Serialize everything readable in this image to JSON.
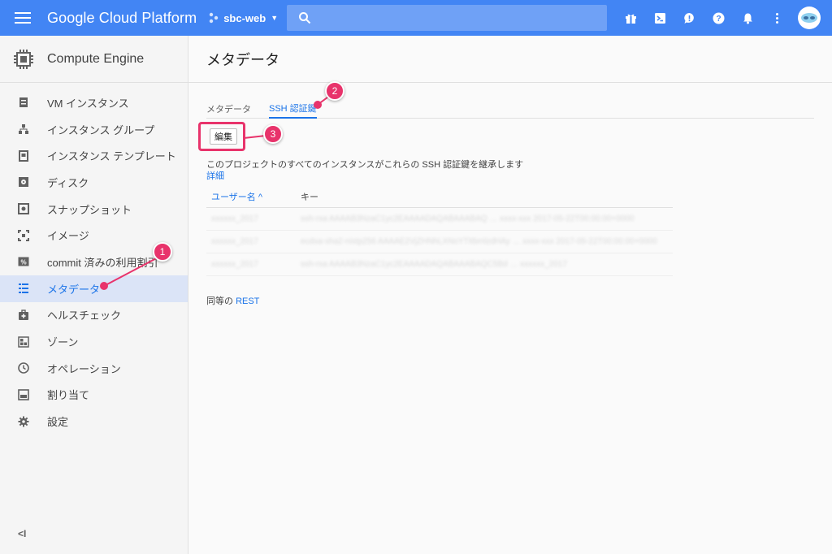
{
  "topbar": {
    "brand": "Google Cloud Platform",
    "project": "sbc-web",
    "search_placeholder": "",
    "accent_color": "#4285f4",
    "icons": [
      "gift-icon",
      "cloud-shell-icon",
      "feedback-icon",
      "help-icon",
      "notifications-icon",
      "more-vert-icon",
      "avatar"
    ]
  },
  "sidebar": {
    "product_title": "Compute Engine",
    "items": [
      {
        "label": "VM インスタンス",
        "icon": "vm-icon"
      },
      {
        "label": "インスタンス グループ",
        "icon": "group-icon"
      },
      {
        "label": "インスタンス テンプレート",
        "icon": "template-icon"
      },
      {
        "label": "ディスク",
        "icon": "disk-icon"
      },
      {
        "label": "スナップショット",
        "icon": "snapshot-icon"
      },
      {
        "label": "イメージ",
        "icon": "image-icon"
      },
      {
        "label": "commit 済みの利用割引",
        "icon": "percent-icon"
      },
      {
        "label": "メタデータ",
        "icon": "metadata-icon"
      },
      {
        "label": "ヘルスチェック",
        "icon": "health-icon"
      },
      {
        "label": "ゾーン",
        "icon": "zone-icon"
      },
      {
        "label": "オペレーション",
        "icon": "clock-icon"
      },
      {
        "label": "割り当て",
        "icon": "quota-icon"
      },
      {
        "label": "設定",
        "icon": "gear-icon"
      }
    ],
    "active_index": 7,
    "collapse_label": "<I"
  },
  "main": {
    "title": "メタデータ",
    "tabs": [
      {
        "label": "メタデータ",
        "active": false
      },
      {
        "label": "SSH 認証鍵",
        "active": true
      }
    ],
    "edit_button": "編集",
    "description": "このプロジェクトのすべてのインスタンスがこれらの SSH 認証鍵を継承します",
    "detail_link": "詳細",
    "table": {
      "columns": [
        "ユーザー名 ^",
        "キー"
      ],
      "rows": [
        [
          "xxxxxx_2017",
          "ssh-rsa AAAAB3NzaC1yc2EAAAADAQABAAABAQ … xxxx-xxx 2017-05-22T00:00:00+0000"
        ],
        [
          "xxxxxx_2017",
          "ecdsa-sha2-nistp256 AAAAE2VjZHNhLXNoYTItbmlzdHAy … xxxx-xxx 2017-05-22T00:00:00+0000"
        ],
        [
          "xxxxxx_2017",
          "ssh-rsa AAAAB3NzaC1yc2EAAAADAQABAAABAQC5Bd … xxxxxx_2017"
        ]
      ]
    },
    "rest_prefix": "同等の",
    "rest_link": "REST"
  },
  "annotations": [
    {
      "number": "1"
    },
    {
      "number": "2"
    },
    {
      "number": "3"
    }
  ]
}
